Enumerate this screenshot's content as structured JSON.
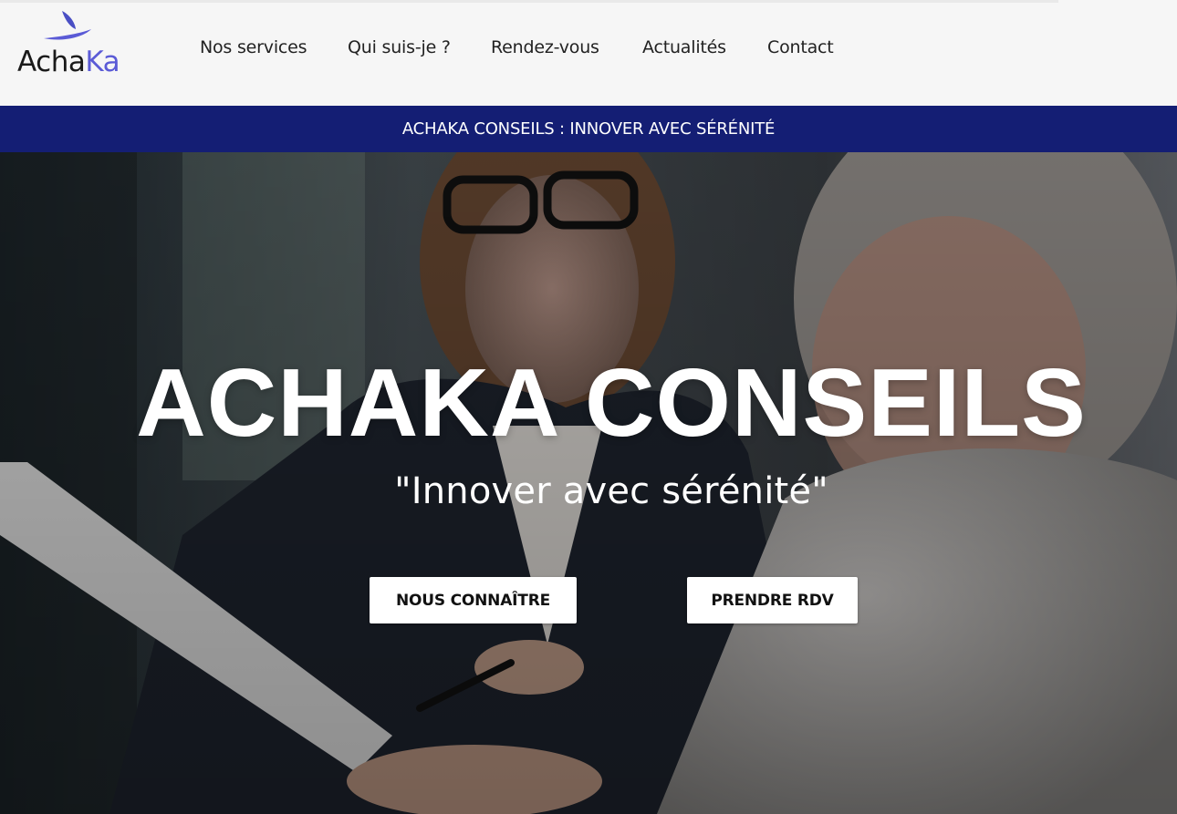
{
  "header": {
    "logo": {
      "part1": "Acha",
      "part2": "Ka"
    },
    "nav": [
      {
        "label": "Nos services"
      },
      {
        "label": "Qui suis-je ?"
      },
      {
        "label": "Rendez-vous"
      },
      {
        "label": "Actualités"
      },
      {
        "label": "Contact"
      }
    ]
  },
  "banner": {
    "text": "ACHAKA CONSEILS : INNOVER AVEC SÉRÉNITÉ"
  },
  "hero": {
    "title": "ACHAKA CONSEILS",
    "subtitle": "\"Innover avec sérénité\"",
    "buttons": [
      {
        "label": "NOUS CONNAÎTRE"
      },
      {
        "label": "PRENDRE RDV"
      }
    ]
  },
  "colors": {
    "banner_bg": "#141e74",
    "logo_accent": "#5b5bd6",
    "header_bg": "#f6f6f6"
  }
}
